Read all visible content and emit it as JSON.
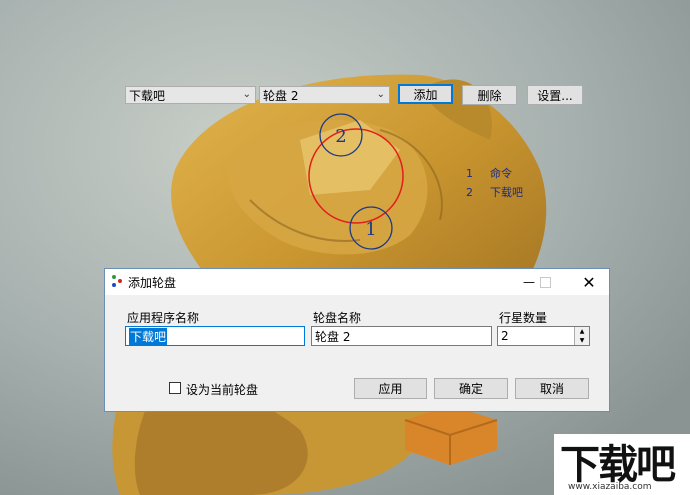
{
  "toolbar": {
    "app_combo_value": "下载吧",
    "wheel_combo_value": "轮盘 2",
    "add_label": "添加",
    "delete_label": "删除",
    "settings_label": "设置..."
  },
  "wheel_preview": {
    "node_1_label": "1",
    "node_2_label": "2",
    "legend": [
      {
        "num": "1",
        "text": "命令"
      },
      {
        "num": "2",
        "text": "下载吧"
      }
    ]
  },
  "dialog": {
    "title": "添加轮盘",
    "app_name_label": "应用程序名称",
    "app_name_value": "下载吧",
    "wheel_name_label": "轮盘名称",
    "wheel_name_value": "轮盘 2",
    "satellite_count_label": "行星数量",
    "satellite_count_value": "2",
    "set_current_label": "设为当前轮盘",
    "apply_label": "应用",
    "ok_label": "确定",
    "cancel_label": "取消"
  },
  "watermark": {
    "text": "下载吧",
    "url": "www.xiazaiba.com"
  }
}
